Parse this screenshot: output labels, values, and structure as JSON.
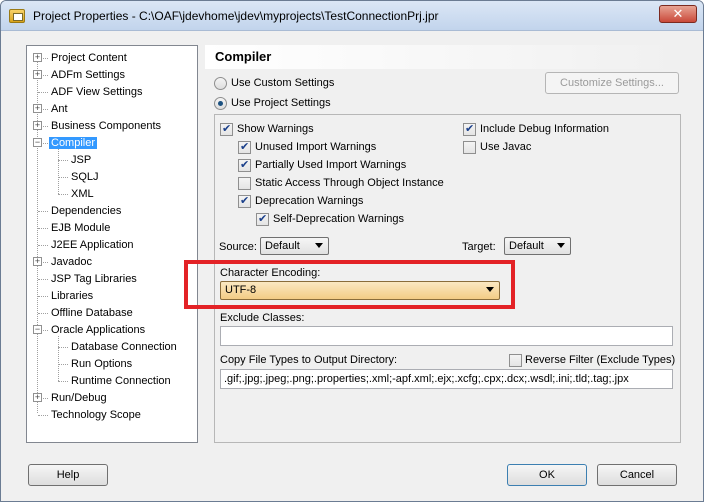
{
  "window": {
    "title": "Project Properties - C:\\OAF\\jdevhome\\jdev\\myprojects\\TestConnectionPrj.jpr",
    "close_glyph": "✕"
  },
  "tree": {
    "items": [
      {
        "label": "Project Content",
        "expander": "+"
      },
      {
        "label": "ADFm Settings",
        "expander": "+"
      },
      {
        "label": "ADF View Settings",
        "expander": ""
      },
      {
        "label": "Ant",
        "expander": "+"
      },
      {
        "label": "Business Components",
        "expander": "+"
      },
      {
        "label": "Compiler",
        "expander": "−",
        "selected": true
      },
      {
        "label": "JSP",
        "expander": ""
      },
      {
        "label": "SQLJ",
        "expander": ""
      },
      {
        "label": "XML",
        "expander": ""
      },
      {
        "label": "Dependencies",
        "expander": ""
      },
      {
        "label": "EJB Module",
        "expander": ""
      },
      {
        "label": "J2EE Application",
        "expander": ""
      },
      {
        "label": "Javadoc",
        "expander": "+"
      },
      {
        "label": "JSP Tag Libraries",
        "expander": ""
      },
      {
        "label": "Libraries",
        "expander": ""
      },
      {
        "label": "Offline Database",
        "expander": ""
      },
      {
        "label": "Oracle Applications",
        "expander": "−"
      },
      {
        "label": "Database Connection",
        "expander": ""
      },
      {
        "label": "Run Options",
        "expander": ""
      },
      {
        "label": "Runtime Connection",
        "expander": ""
      },
      {
        "label": "Run/Debug",
        "expander": "+"
      },
      {
        "label": "Technology Scope",
        "expander": ""
      }
    ]
  },
  "compiler": {
    "title": "Compiler",
    "use_custom_settings": "Use Custom Settings",
    "use_project_settings": "Use Project Settings",
    "customize_settings": "Customize Settings...",
    "show_warnings": "Show Warnings",
    "unused_import_warnings": "Unused Import Warnings",
    "partially_used_import_warnings": "Partially Used Import Warnings",
    "static_access": "Static Access Through Object Instance",
    "deprecation_warnings": "Deprecation Warnings",
    "self_deprecation_warnings": "Self-Deprecation Warnings",
    "include_debug_info": "Include Debug Information",
    "use_javac": "Use Javac",
    "source_label": "Source:",
    "source_value": "Default",
    "target_label": "Target:",
    "target_value": "Default",
    "character_encoding_label": "Character Encoding:",
    "character_encoding_value": "UTF-8",
    "exclude_classes_label": "Exclude Classes:",
    "exclude_classes_value": "",
    "copy_file_types_label": "Copy File Types to Output Directory:",
    "reverse_filter": "Reverse Filter (Exclude Types)",
    "copy_file_types_value": ".gif;.jpg;.jpeg;.png;.properties;.xml;-apf.xml;.ejx;.xcfg;.cpx;.dcx;.wsdl;.ini;.tld;.tag;.jpx"
  },
  "footer": {
    "help": "Help",
    "ok": "OK",
    "cancel": "Cancel"
  },
  "colors": {
    "selection": "#3399ff",
    "highlight_border": "#e32226"
  }
}
